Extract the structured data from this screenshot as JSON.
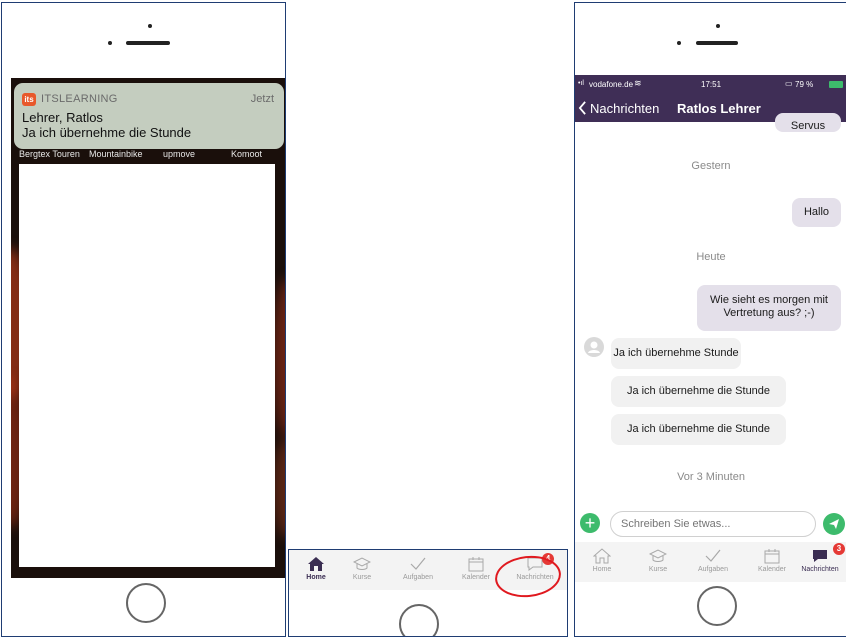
{
  "left_phone": {
    "notification": {
      "app_icon_text": "its",
      "app_name": "ITSLEARNING",
      "time": "Jetzt",
      "title": "Lehrer, Ratlos",
      "body": "Ja ich übernehme die Stunde"
    },
    "background_nav": [
      "Bergtex Touren",
      "Mountainbike",
      "upmove",
      "Komoot"
    ]
  },
  "tab_bar": {
    "items": [
      {
        "label": "Home",
        "icon": "home-icon",
        "active": true
      },
      {
        "label": "Kurse",
        "icon": "graduation-cap-icon",
        "active": false
      },
      {
        "label": "Aufgaben",
        "icon": "checkmark-icon",
        "active": false
      },
      {
        "label": "Kalender",
        "icon": "calendar-icon",
        "active": false
      },
      {
        "label": "Nachrichten",
        "icon": "chat-bubble-icon",
        "active": false
      }
    ],
    "messages_badge_middle": "4",
    "messages_badge_right": "3",
    "highlight_color": "#e0191f"
  },
  "right_phone": {
    "status": {
      "carrier": "vodafone.de",
      "time": "17:51",
      "battery": "79 %"
    },
    "nav": {
      "back_label": "Nachrichten",
      "title": "Ratlos Lehrer"
    },
    "messages": [
      {
        "type": "outgoing",
        "text": "Servus"
      },
      {
        "type": "day",
        "text": "Gestern"
      },
      {
        "type": "outgoing",
        "text": "Hallo"
      },
      {
        "type": "day",
        "text": "Heute"
      },
      {
        "type": "outgoing",
        "text": "Wie sieht es morgen mit Vertretung aus? ;-)"
      },
      {
        "type": "incoming",
        "text": "Ja ich übernehme Stunde"
      },
      {
        "type": "incoming",
        "text": "Ja ich übernehme die Stunde"
      },
      {
        "type": "incoming",
        "text": "Ja ich übernehme die Stunde"
      },
      {
        "type": "day",
        "text": "Vor 3 Minuten"
      }
    ],
    "composer": {
      "placeholder": "Schreiben Sie etwas..."
    }
  },
  "colors": {
    "header": "#3f2e56",
    "accent_green": "#3dbb6c",
    "badge_red": "#e53935",
    "outgoing_bubble": "#e4e0ea",
    "frame_border": "#1f3d73"
  }
}
